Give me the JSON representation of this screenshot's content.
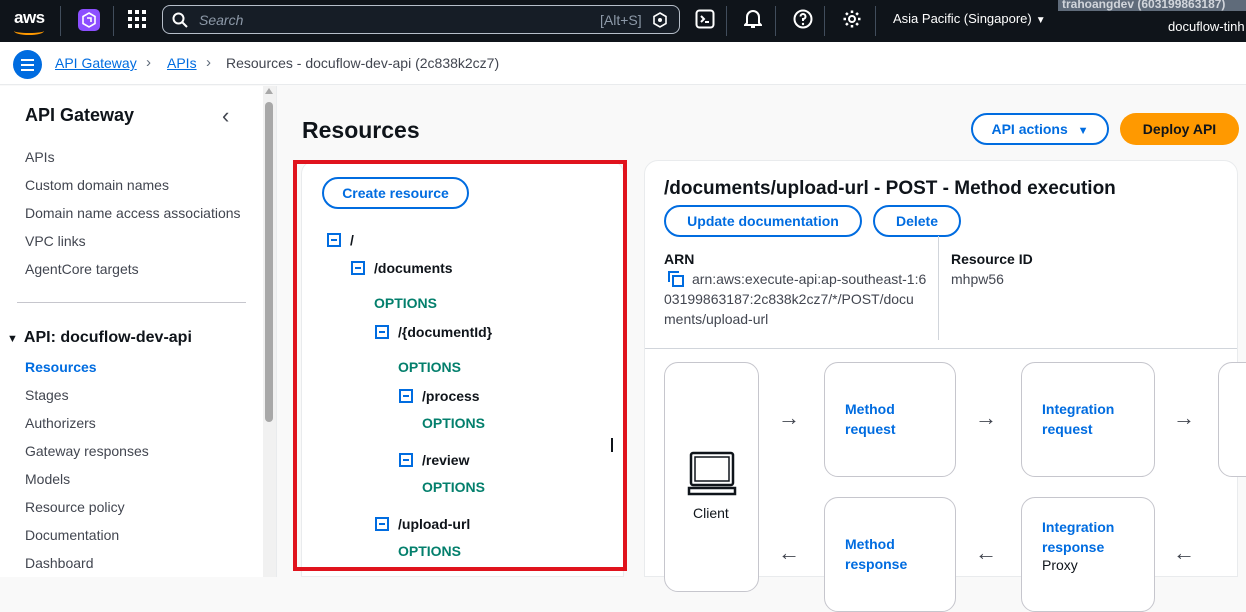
{
  "topnav": {
    "logo": "aws",
    "search_placeholder": "Search",
    "search_shortcut": "[Alt+S]",
    "region": "Asia Pacific (Singapore)",
    "account": "trahoangdev (603199863187)",
    "user": "docuflow-tinh",
    "icons": [
      "cloudshell-icon",
      "bell-icon",
      "help-icon",
      "gear-icon"
    ]
  },
  "breadcrumb": {
    "items": [
      "API Gateway",
      "APIs"
    ],
    "current": "Resources - docuflow-dev-api (2c838k2cz7)"
  },
  "sidebar": {
    "title": "API Gateway",
    "top_items": [
      "APIs",
      "Custom domain names",
      "Domain name access associations",
      "VPC links",
      "AgentCore targets"
    ],
    "api_section": "API: docuflow-dev-api",
    "api_items": [
      "Resources",
      "Stages",
      "Authorizers",
      "Gateway responses",
      "Models",
      "Resource policy",
      "Documentation",
      "Dashboard"
    ],
    "active_item": "Resources"
  },
  "main": {
    "title": "Resources",
    "api_actions_label": "API actions",
    "deploy_label": "Deploy API",
    "create_resource_label": "Create resource"
  },
  "tree": {
    "root": "/",
    "documents": "/documents",
    "documents_method": "OPTIONS",
    "documentId": "/{documentId}",
    "documentId_method": "OPTIONS",
    "process": "/process",
    "process_method": "OPTIONS",
    "review": "/review",
    "review_method": "OPTIONS",
    "upload_url": "/upload-url",
    "upload_url_method": "OPTIONS"
  },
  "execution": {
    "title": "/documents/upload-url - POST - Method execution",
    "update_doc_label": "Update documentation",
    "delete_label": "Delete",
    "arn_label": "ARN",
    "arn_line1": "arn:aws:execute-api:ap-southeast-1:6",
    "arn_line2": "03199863187:2c838k2cz7/*/POST/docu",
    "arn_line3": "ments/upload-url",
    "resource_id_label": "Resource ID",
    "resource_id": "mhpw56",
    "client_label": "Client",
    "method_request": [
      "Method",
      "request"
    ],
    "integration_request": [
      "Integration",
      "request"
    ],
    "method_response": [
      "Method",
      "response"
    ],
    "integration_response": [
      "Integration",
      "response"
    ],
    "integration_type": "Proxy"
  }
}
